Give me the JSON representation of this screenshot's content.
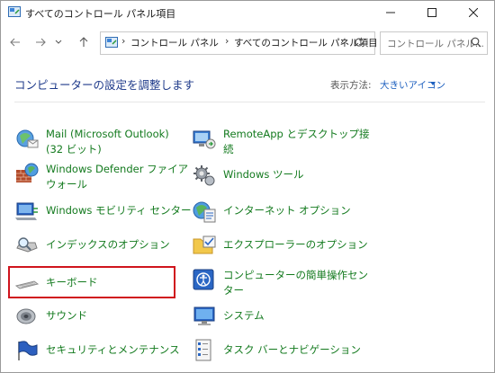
{
  "window": {
    "title": "すべてのコントロール パネル項目"
  },
  "address": {
    "segments": [
      "コントロール パネル",
      "すべてのコントロール パネル項目"
    ],
    "search_placeholder": "コントロール パネル..."
  },
  "header": {
    "title": "コンピューターの設定を調整します",
    "view_label": "表示方法:",
    "view_value": "大きいアイコン"
  },
  "items_left": [
    {
      "line1": "Mail (Microsoft Outlook)",
      "line2": "(32 ビット)",
      "icon": "mail-icon"
    },
    {
      "line1": "Windows Defender ファイア",
      "line2": "ウォール",
      "icon": "firewall-icon"
    },
    {
      "line1": "Windows モビリティ センター",
      "line2": "",
      "icon": "mobility-center-icon"
    },
    {
      "line1": "インデックスのオプション",
      "line2": "",
      "icon": "indexing-icon"
    },
    {
      "line1": "キーボード",
      "line2": "",
      "icon": "keyboard-icon"
    },
    {
      "line1": "サウンド",
      "line2": "",
      "icon": "sound-icon"
    },
    {
      "line1": "セキュリティとメンテナンス",
      "line2": "",
      "icon": "security-flag-icon"
    }
  ],
  "items_right": [
    {
      "line1": "RemoteApp とデスクトップ接",
      "line2": "続",
      "icon": "remoteapp-icon"
    },
    {
      "line1": "Windows ツール",
      "line2": "",
      "icon": "windows-tools-icon"
    },
    {
      "line1": "インターネット オプション",
      "line2": "",
      "icon": "internet-options-icon"
    },
    {
      "line1": "エクスプローラーのオプション",
      "line2": "",
      "icon": "folder-options-icon"
    },
    {
      "line1": "コンピューターの簡単操作セン",
      "line2": "ター",
      "icon": "ease-of-access-icon"
    },
    {
      "line1": "システム",
      "line2": "",
      "icon": "system-icon"
    },
    {
      "line1": "タスク バーとナビゲーション",
      "line2": "",
      "icon": "taskbar-icon"
    }
  ],
  "colors": {
    "link_green": "#137a1e",
    "title_blue": "#1e3a8a",
    "accent_blue": "#1c5fbf",
    "highlight_red": "#d0141d"
  }
}
